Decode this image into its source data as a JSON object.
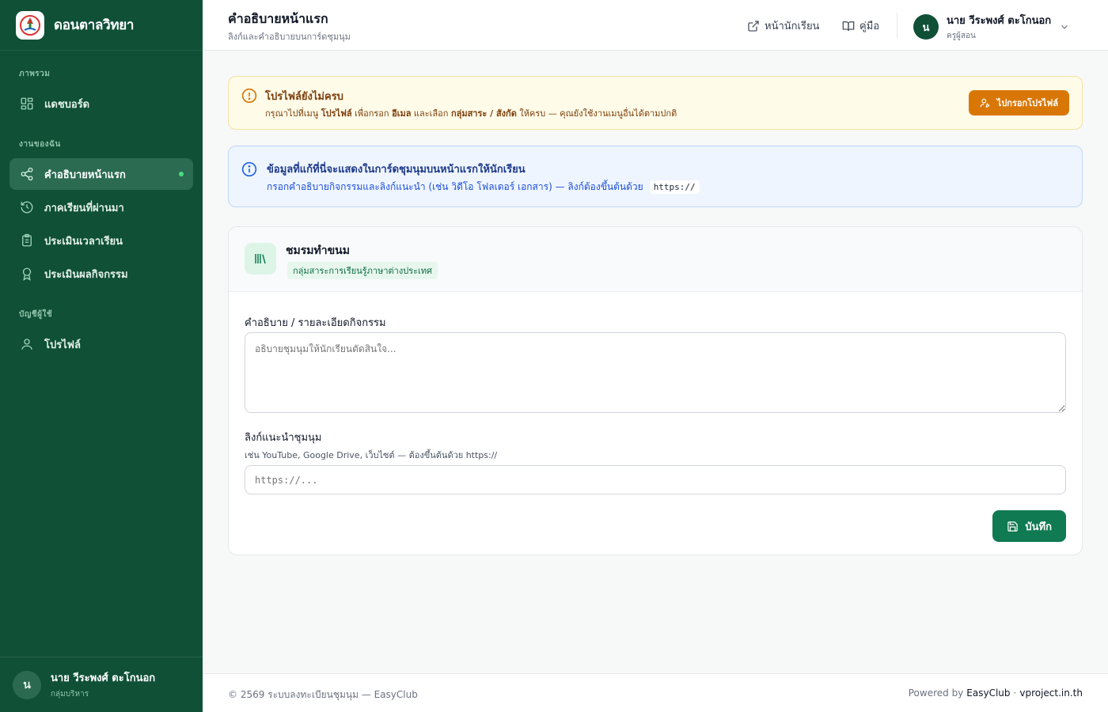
{
  "brand": {
    "name": "ดอนตาลวิทยา"
  },
  "sidebar": {
    "sections": [
      {
        "title": "ภาพรวม"
      },
      {
        "title": "งานของฉัน"
      },
      {
        "title": "บัญชีผู้ใช้"
      }
    ],
    "items": [
      {
        "label": "แดชบอร์ด",
        "icon": "dashboard-icon"
      },
      {
        "label": "คำอธิบายหน้าแรก",
        "icon": "share-icon",
        "active": true
      },
      {
        "label": "ภาคเรียนที่ผ่านมา",
        "icon": "history-icon"
      },
      {
        "label": "ประเมินเวลาเรียน",
        "icon": "clipboard-icon"
      },
      {
        "label": "ประเมินผลกิจกรรม",
        "icon": "award-icon"
      },
      {
        "label": "โปรไฟล์",
        "icon": "user-icon"
      }
    ],
    "footer": {
      "avatar": "น",
      "name": "นาย วีระพงศ์ ตะโกนอก",
      "role": "กลุ่มบริหาร"
    }
  },
  "topbar": {
    "title": "คำอธิบายหน้าแรก",
    "subtitle": "ลิงก์และคำอธิบายบนการ์ดชุมนุม",
    "links": [
      {
        "label": "หน้านักเรียน",
        "icon": "external-link-icon"
      },
      {
        "label": "คู่มือ",
        "icon": "book-icon"
      }
    ],
    "user": {
      "avatar": "น",
      "name": "นาย วีระพงศ์ ตะโกนอก",
      "role": "ครูผู้สอน"
    }
  },
  "warning": {
    "title": "โปรไฟล์ยังไม่ครบ",
    "text_1": "กรุณาไปที่เมนู ",
    "menu": "โปรไฟล์",
    "text_2": " เพื่อกรอก ",
    "email": "อีเมล",
    "text_3": " และเลือก ",
    "groups": "กลุ่มสาระ / สังกัด",
    "text_4": " ให้ครบ — คุณยังใช้งานเมนูอื่นได้ตามปกติ",
    "button": "ไปกรอกโปรไฟล์"
  },
  "info": {
    "title": "ข้อมูลที่แก้ที่นี่จะแสดงในการ์ดชุมนุมบนหน้าแรกให้นักเรียน",
    "text": "กรอกคำอธิบายกิจกรรมและลิงก์แนะนำ (เช่น วิดีโอ โฟลเดอร์ เอกสาร) — ลิงก์ต้องขึ้นต้นด้วย",
    "code": "https://"
  },
  "club": {
    "name": "ชมรมทำขนม",
    "group": "กลุ่มสาระการเรียนรู้ภาษาต่างประเทศ"
  },
  "form": {
    "desc_label": "คำอธิบาย / รายละเอียดกิจกรรม",
    "desc_placeholder": "อธิบายชุมนุมให้นักเรียนตัดสินใจ...",
    "desc_value": "",
    "link_label": "ลิงก์แนะนำชุมนุม",
    "link_help": "เช่น YouTube, Google Drive, เว็บไซต์ — ต้องขึ้นต้นด้วย https://",
    "link_placeholder": "https://...",
    "link_value": "",
    "save": "บันทึก"
  },
  "footer": {
    "left": "© 2569 ระบบลงทะเบียนชุมนุม — EasyClub",
    "powered": "Powered by",
    "product": "EasyClub",
    "sep": "·",
    "site": "vproject.in.th"
  },
  "colors": {
    "sidebar_bg": "#0f5037",
    "accent": "#107a52",
    "warning_bg": "#fefbe8",
    "warning_button": "#d97706",
    "info_bg": "#eef5ff"
  }
}
